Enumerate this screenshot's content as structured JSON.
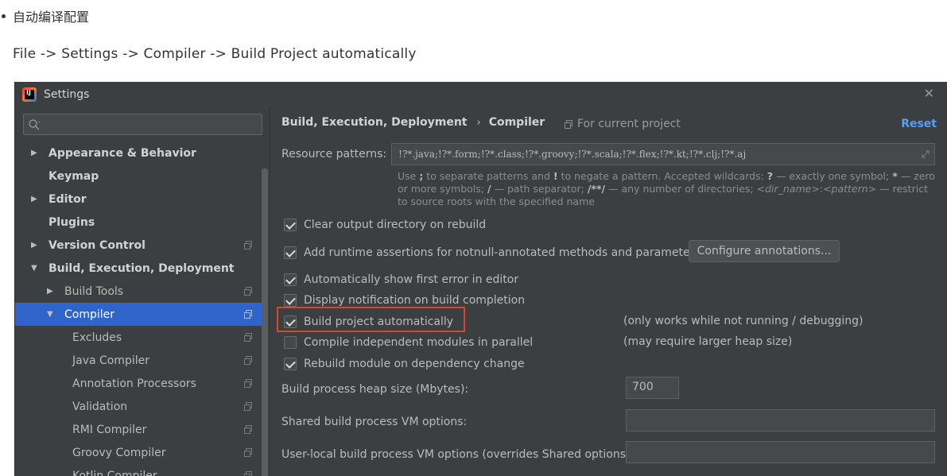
{
  "article": {
    "bullet_text": "自动编译配置",
    "path_text": "File -> Settings -> Compiler -> Build Project automatically"
  },
  "window": {
    "title": "Settings",
    "app_icon_label": "IJ",
    "close_glyph": "✕"
  },
  "sidebar": {
    "search_placeholder": "",
    "items": [
      {
        "label": "Appearance & Behavior",
        "arrow": "▶",
        "bold": true,
        "indent": 0,
        "copy": false
      },
      {
        "label": "Keymap",
        "arrow": "",
        "bold": true,
        "indent": 0,
        "copy": false
      },
      {
        "label": "Editor",
        "arrow": "▶",
        "bold": true,
        "indent": 0,
        "copy": false
      },
      {
        "label": "Plugins",
        "arrow": "",
        "bold": true,
        "indent": 0,
        "copy": false
      },
      {
        "label": "Version Control",
        "arrow": "▶",
        "bold": true,
        "indent": 0,
        "copy": true
      },
      {
        "label": "Build, Execution, Deployment",
        "arrow": "▼",
        "bold": true,
        "indent": 0,
        "copy": false
      },
      {
        "label": "Build Tools",
        "arrow": "▶",
        "bold": false,
        "indent": 1,
        "copy": true
      },
      {
        "label": "Compiler",
        "arrow": "▼",
        "bold": false,
        "indent": 1,
        "copy": true,
        "selected": true
      },
      {
        "label": "Excludes",
        "arrow": "",
        "bold": false,
        "indent": 2,
        "copy": true
      },
      {
        "label": "Java Compiler",
        "arrow": "",
        "bold": false,
        "indent": 2,
        "copy": true
      },
      {
        "label": "Annotation Processors",
        "arrow": "",
        "bold": false,
        "indent": 2,
        "copy": true
      },
      {
        "label": "Validation",
        "arrow": "",
        "bold": false,
        "indent": 2,
        "copy": true
      },
      {
        "label": "RMI Compiler",
        "arrow": "",
        "bold": false,
        "indent": 2,
        "copy": true
      },
      {
        "label": "Groovy Compiler",
        "arrow": "",
        "bold": false,
        "indent": 2,
        "copy": true
      },
      {
        "label": "Kotlin Compiler",
        "arrow": "",
        "bold": false,
        "indent": 2,
        "copy": true
      }
    ]
  },
  "main": {
    "breadcrumb_parent": "Build, Execution, Deployment",
    "breadcrumb_sep": "›",
    "breadcrumb_current": "Compiler",
    "for_project": "For current project",
    "reset": "Reset",
    "resource_label": "Resource patterns:",
    "resource_value": "!?*.java;!?*.form;!?*.class;!?*.groovy;!?*.scala;!?*.flex;!?*.kt;!?*.clj;!?*.aj",
    "hint": {
      "t1": "Use ",
      "b1": ";",
      "t2": " to separate patterns and ",
      "b2": "!",
      "t3": " to negate a pattern. Accepted wildcards: ",
      "b3": "?",
      "t4": " — exactly one symbol; ",
      "b4": "*",
      "t5": " — zero or more symbols; ",
      "b5": "/",
      "t6": " — path separator; ",
      "b6": "/**/",
      "t7": " — any number of directories; ",
      "i1": "<dir_name>",
      "t8": ":",
      "i2": "<pattern>",
      "t9": " — restrict to source roots with the specified name"
    },
    "checkboxes": {
      "clear_output": "Clear output directory on rebuild",
      "runtime_assert": "Add runtime assertions for notnull-annotated methods and parameters",
      "show_first_error": "Automatically show first error in editor",
      "display_notification": "Display notification on build completion",
      "build_auto": "Build project automatically",
      "compile_parallel": "Compile independent modules in parallel",
      "rebuild_module": "Rebuild module on dependency change"
    },
    "configure_button": "Configure annotations...",
    "note_build_auto": "(only works while not running / debugging)",
    "note_parallel": "(may require larger heap size)",
    "heap_label": "Build process heap size (Mbytes):",
    "heap_value": "700",
    "shared_vm_label": "Shared build process VM options:",
    "shared_vm_value": "",
    "user_vm_label": "User-local build process VM options (overrides Shared options):",
    "user_vm_value": ""
  },
  "colors": {
    "window_bg": "#3c3f41",
    "selection": "#2f65ca",
    "link": "#589df6",
    "highlight": "#d9472b"
  }
}
